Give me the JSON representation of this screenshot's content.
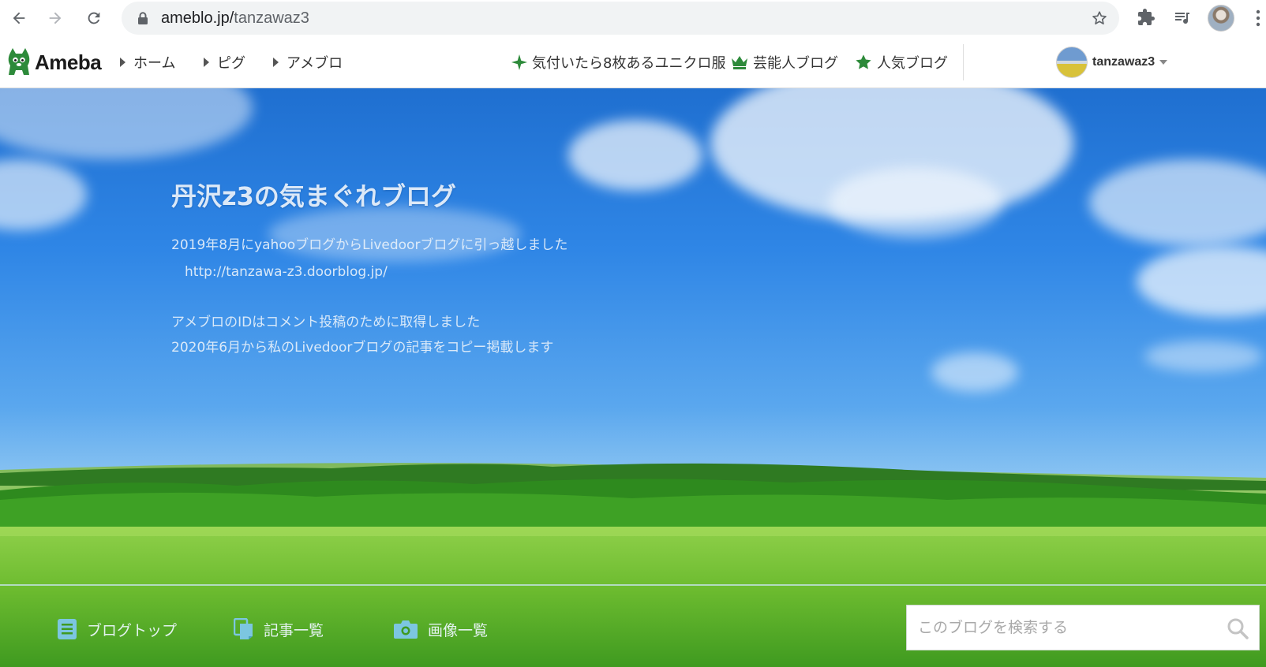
{
  "browser": {
    "url_host": "ameblo.jp/",
    "url_path": "tanzawaz3",
    "icons": [
      "back-icon",
      "forward-icon",
      "reload-icon",
      "lock-icon",
      "bookmark-star-icon",
      "extensions-icon",
      "media-queue-icon",
      "profile-avatar",
      "menu-kebab-icon"
    ]
  },
  "ameba": {
    "logo": "Ameba",
    "nav": [
      {
        "label": "ホーム"
      },
      {
        "label": "ピグ"
      },
      {
        "label": "アメブロ"
      }
    ],
    "promos": [
      {
        "label": "気付いたら8枚あるユニクロ服",
        "icon": "sparkle-icon"
      },
      {
        "label": "芸能人ブログ",
        "icon": "crown-icon"
      },
      {
        "label": "人気ブログ",
        "icon": "star-icon"
      }
    ],
    "user": {
      "name": "tanzawaz3"
    },
    "accent_color": "#2d8a3a"
  },
  "blog": {
    "title": "丹沢z3の気まぐれブログ",
    "description": [
      "2019年8月にyahooブログからLivedoorブログに引っ越しました",
      "　http://tanzawa-z3.doorblog.jp/",
      "",
      "アメブロのIDはコメント投稿のために取得しました",
      "2020年6月から私のLivedoorブログの記事をコピー掲載します"
    ],
    "nav": [
      {
        "label": "ブログトップ",
        "icon": "document-icon"
      },
      {
        "label": "記事一覧",
        "icon": "copy-pages-icon"
      },
      {
        "label": "画像一覧",
        "icon": "camera-icon"
      }
    ],
    "search": {
      "placeholder": "このブログを検索する",
      "value": ""
    },
    "nav_icon_color": "#7cc6e0"
  }
}
